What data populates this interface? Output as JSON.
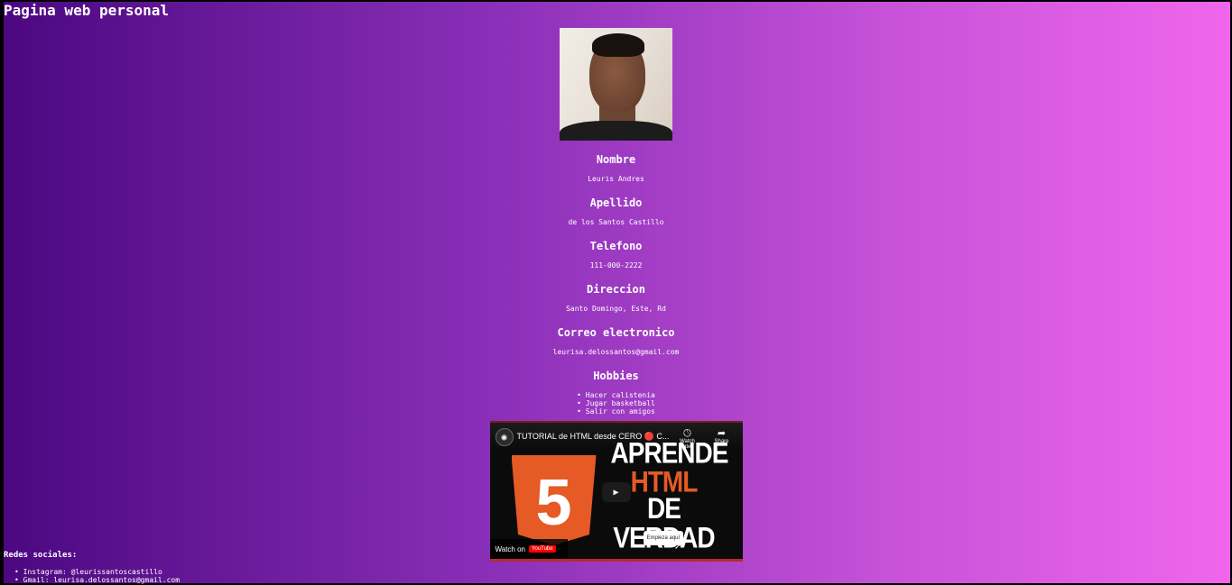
{
  "page": {
    "title": "Pagina web personal"
  },
  "profile": {
    "photo_alt": "",
    "fields": [
      {
        "label": "Nombre",
        "value": "Leuris Andres"
      },
      {
        "label": "Apellido",
        "value": "de los Santos Castillo"
      },
      {
        "label": "Telefono",
        "value": "111-000-2222"
      },
      {
        "label": "Direccion",
        "value": "Santo Domingo, Este, Rd"
      },
      {
        "label": "Correo electronico",
        "value": "leurisa.delossantos@gmail.com"
      }
    ],
    "hobbies": {
      "label": "Hobbies",
      "items": [
        "Hacer calistenia",
        "Jugar basketball",
        "Salir con amigos"
      ]
    }
  },
  "video": {
    "title": "TUTORIAL de HTML desde CERO 🔴 C...",
    "watch_later": "Watch later",
    "share": "Share",
    "thumb_line1": "APRENDE",
    "thumb_line2": "HTML",
    "thumb_line3": "DE VERDAD",
    "shield_number": "5",
    "button_text": "Empieza aquí",
    "watch_on": "Watch on",
    "yt_logo": "YouTube"
  },
  "social": {
    "title": "Redes sociales:",
    "items": [
      "Instagram: @leurissantoscastillo",
      "Gmail: leurisa.delossantos@gmail.com"
    ]
  },
  "colors": {
    "gradient_start": "#4b0780",
    "gradient_end": "#f066ec",
    "html_orange": "#e65a26"
  },
  "icons": [
    "clock-icon",
    "share-icon",
    "play-icon",
    "cursor-icon",
    "channel-avatar-icon"
  ]
}
